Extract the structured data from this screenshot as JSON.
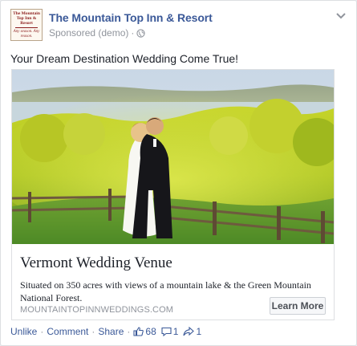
{
  "post": {
    "page_name": "The Mountain Top Inn & Resort",
    "sponsored_label": "Sponsored (demo)",
    "separator": "·",
    "message": "Your Dream Destination Wedding Come True!",
    "audience_icon": "globe-icon",
    "menu_icon": "chevron-down-icon"
  },
  "logo": {
    "line1": "The Mountain Top Inn & Resort",
    "line2": "Any season. Any reason.",
    "brand_color": "#8b1c1c"
  },
  "link": {
    "title": "Vermont Wedding Venue",
    "description": "Situated on 350 acres with views of a mountain lake & the Green Mountain National Forest.",
    "domain": "MOUNTAINTOPINNWEDDINGS.COM",
    "cta_label": "Learn More",
    "image_subject": "wedding couple embracing in a green meadow with a lake behind"
  },
  "actions": {
    "like_label": "Unlike",
    "comment_label": "Comment",
    "share_label": "Share",
    "separator": "·",
    "likes_count": "68",
    "comments_count": "1",
    "shares_count": "1"
  },
  "colors": {
    "link_blue": "#3b5998",
    "meta_gray": "#90949c",
    "border": "#dddfe2"
  }
}
